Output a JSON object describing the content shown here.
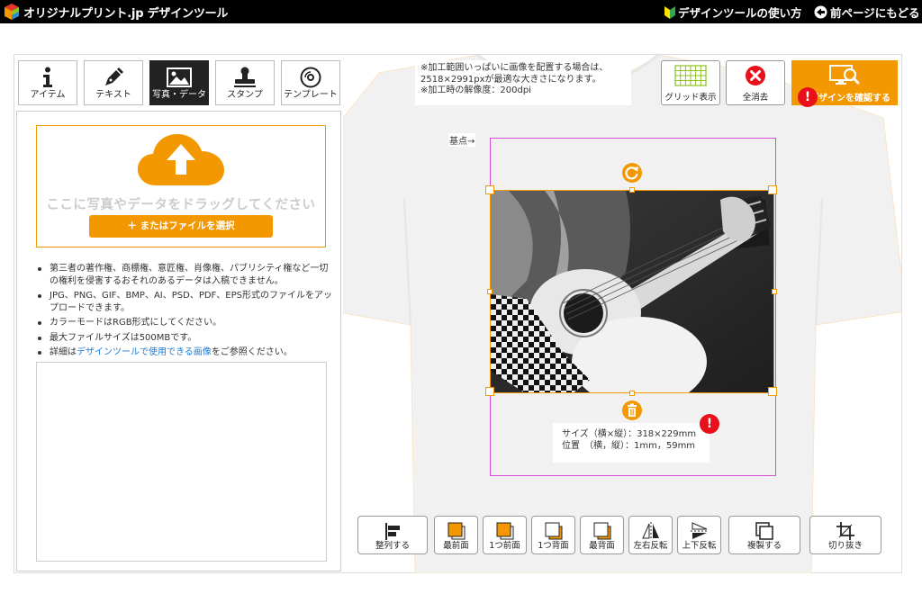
{
  "header": {
    "site_name": "オリジナルプリント.jp  デザインツール",
    "guide_link": "デザインツールの使い方",
    "back_link": "前ページにもどる"
  },
  "tabs": [
    {
      "label": "アイテム",
      "icon": "info-icon"
    },
    {
      "label": "テキスト",
      "icon": "pen-icon"
    },
    {
      "label": "写真・データ",
      "icon": "image-icon",
      "active": true
    },
    {
      "label": "スタンプ",
      "icon": "stamp-icon"
    },
    {
      "label": "テンプレート",
      "icon": "disc-icon"
    }
  ],
  "upload": {
    "drop_text": "ここに写真やデータをドラッグしてください",
    "select_button": "＋ またはファイルを選択",
    "notes": [
      "第三者の著作権、商標権、意匠権、肖像権、パブリシティ権など一切の権利を侵害するおそれのあるデータは入稿できません。",
      "JPG、PNG、GIF、BMP、AI、PSD、PDF、EPS形式のファイルをアップロードできます。",
      "カラーモードはRGB形式にしてください。",
      "最大ファイルサイズは500MBです。"
    ],
    "last_note_prefix": "詳細は",
    "last_note_link": "デザインツールで使用できる画像",
    "last_note_suffix": "をご参照ください。"
  },
  "canvas": {
    "info_lines": [
      "※加工範囲いっぱいに画像を配置する場合は、",
      "2518×2991pxが最適な大きさになります。",
      "※加工時の解像度：200dpi"
    ],
    "grid_label": "グリッド表示",
    "clear_label": "全消去",
    "confirm_label": "デザインを確認する",
    "alert_mark": "!",
    "origin_label": "基点→",
    "size_info": "サイズ（横×縦）：318×229mm\n位置　（横，縦）：1mm，59mm"
  },
  "bottom_toolbar": [
    {
      "label": "整列する",
      "icon": "align-icon"
    },
    {
      "label": "最前面",
      "icon": "bring-front-icon"
    },
    {
      "label": "1つ前面",
      "icon": "bring-forward-icon"
    },
    {
      "label": "1つ背面",
      "icon": "send-backward-icon"
    },
    {
      "label": "最背面",
      "icon": "send-back-icon"
    },
    {
      "label": "左右反転",
      "icon": "flip-horizontal-icon"
    },
    {
      "label": "上下反転",
      "icon": "flip-vertical-icon"
    },
    {
      "label": "複製する",
      "icon": "duplicate-icon"
    },
    {
      "label": "切り抜き",
      "icon": "crop-icon"
    }
  ],
  "colors": {
    "accent": "#f39800",
    "header_bg": "#000000",
    "alert": "#e8101a",
    "frame": "#d34fd8",
    "link": "#1a7bd6"
  }
}
